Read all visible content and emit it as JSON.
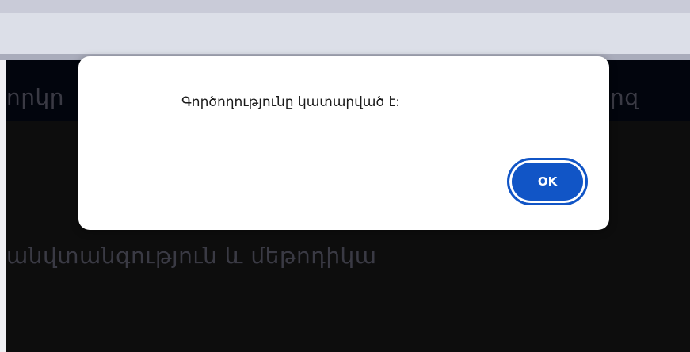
{
  "background": {
    "nav_left_text": "որկր",
    "nav_right_text": "րզ",
    "section_text": "անվտանգություն և մեթոդիկա"
  },
  "dialog": {
    "message": "Գործողությունը կատարված է:",
    "ok_label": "OK"
  },
  "colors": {
    "accent": "#1155c6",
    "overlay": "#0d0d0d",
    "browser_bar": "#dcdfe8"
  }
}
